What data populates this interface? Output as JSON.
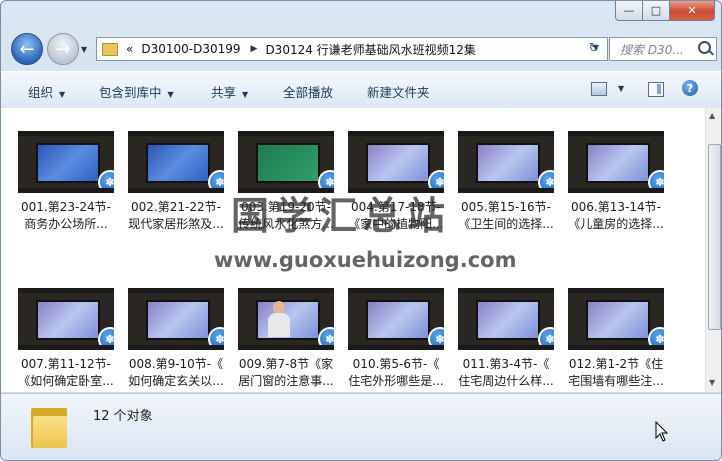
{
  "window": {
    "minimize_glyph": "—",
    "maximize_glyph": "□",
    "close_glyph": "✕"
  },
  "address": {
    "overflow": "«",
    "crumbs": [
      "D30100-D30199",
      "D30124 行谦老师基础风水班视频12集"
    ]
  },
  "search": {
    "placeholder": "搜索 D30..."
  },
  "toolbar": {
    "organize": "组织",
    "include_in_library": "包含到库中",
    "share": "共享",
    "play_all": "全部播放",
    "new_folder": "新建文件夹"
  },
  "files": [
    {
      "line1": "001.第23-24节-",
      "line2": "商务办公场所..."
    },
    {
      "line1": "002.第21-22节-",
      "line2": "现代家居形煞及..."
    },
    {
      "line1": "003.第19-20节-",
      "line2": "传统风水化煞方..."
    },
    {
      "line1": "004.第17-18节-",
      "line2": "《家中的植物阳..."
    },
    {
      "line1": "005.第15-16节-",
      "line2": "《卫生间的选择..."
    },
    {
      "line1": "006.第13-14节-",
      "line2": "《儿童房的选择..."
    },
    {
      "line1": "007.第11-12节-",
      "line2": "《如何确定卧室..."
    },
    {
      "line1": "008.第9-10节-《",
      "line2": "如何确定玄关以..."
    },
    {
      "line1": "009.第7-8节《家",
      "line2": "居门窗的注意事..."
    },
    {
      "line1": "010.第5-6节-《",
      "line2": "住宅外形哪些是..."
    },
    {
      "line1": "011.第3-4节-《",
      "line2": "住宅周边什么样..."
    },
    {
      "line1": "012.第1-2节《住",
      "line2": "宅围墙有哪些注..."
    }
  ],
  "watermark": {
    "chinese": "国学汇总站",
    "url": "www.guoxuehuizong.com"
  },
  "status": {
    "count": "12 个对象"
  }
}
